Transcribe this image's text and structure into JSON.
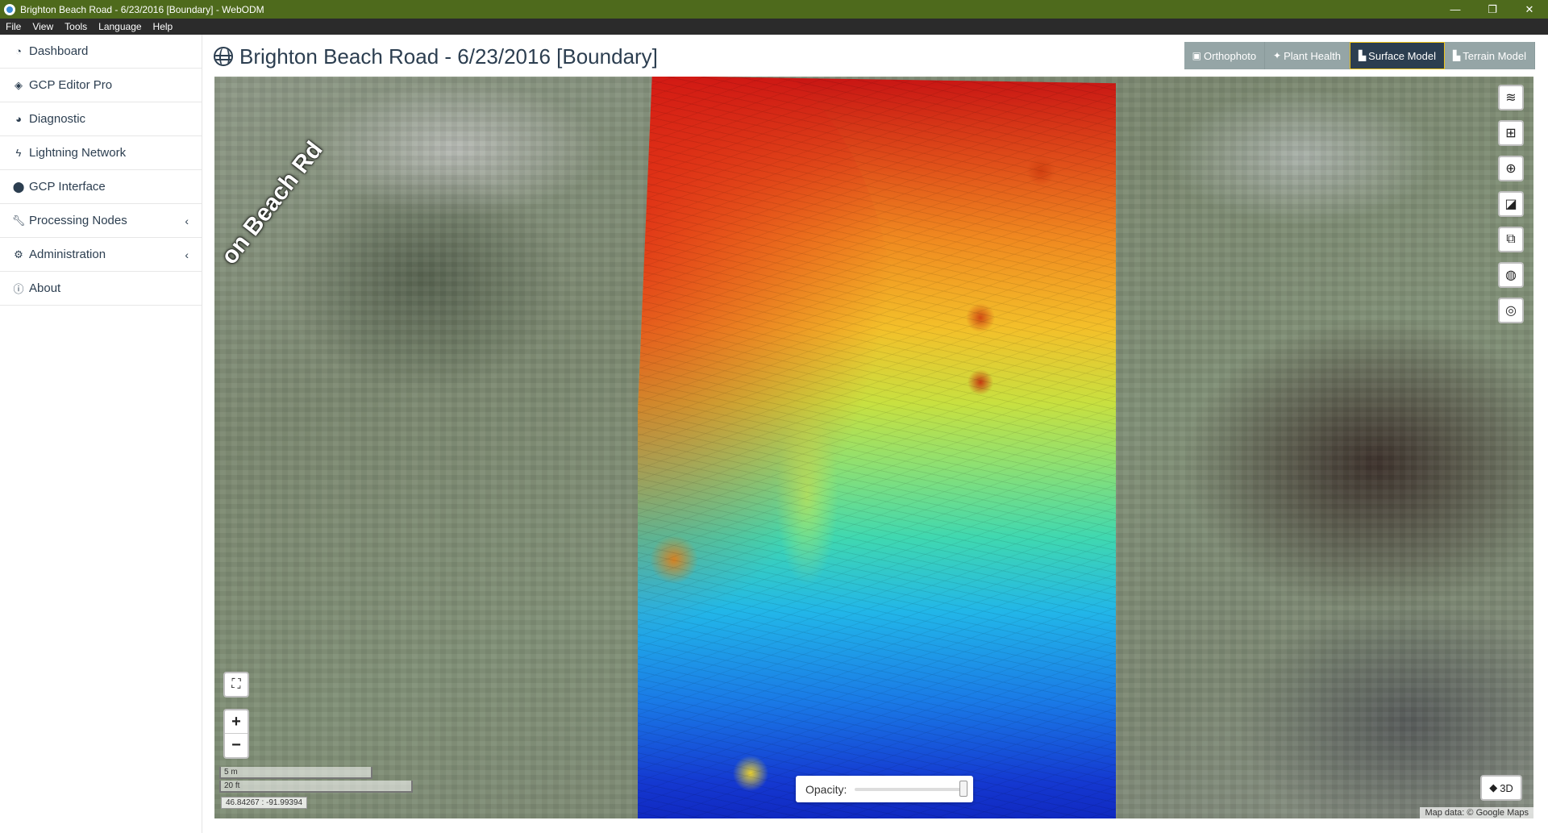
{
  "window": {
    "title": "Brighton Beach Road - 6/23/2016 [Boundary] - WebODM",
    "controls": [
      "—",
      "❐",
      "✕"
    ]
  },
  "menu": [
    "File",
    "View",
    "Tools",
    "Language",
    "Help"
  ],
  "sidebar": {
    "items": [
      {
        "label": "Dashboard",
        "icon": "dashboard-icon"
      },
      {
        "label": "GCP Editor Pro",
        "icon": "gcp-editor-icon"
      },
      {
        "label": "Diagnostic",
        "icon": "pie-chart-icon"
      },
      {
        "label": "Lightning Network",
        "icon": "bolt-icon"
      },
      {
        "label": "GCP Interface",
        "icon": "map-marker-icon"
      },
      {
        "label": "Processing Nodes",
        "icon": "wrench-icon",
        "expandable": true
      },
      {
        "label": "Administration",
        "icon": "cogs-icon",
        "expandable": true
      },
      {
        "label": "About",
        "icon": "info-icon"
      }
    ]
  },
  "header": {
    "title": "Brighton Beach Road - 6/23/2016 [Boundary]"
  },
  "layer_tabs": [
    {
      "label": "Orthophoto",
      "icon": "image-icon",
      "active": false
    },
    {
      "label": "Plant Health",
      "icon": "leaf-icon",
      "active": false
    },
    {
      "label": "Surface Model",
      "icon": "area-chart-icon",
      "active": true
    },
    {
      "label": "Terrain Model",
      "icon": "area-chart-icon",
      "active": false
    }
  ],
  "map": {
    "road_label": "on Beach Rd",
    "scale_metric": "5 m",
    "scale_imperial": "20 ft",
    "coordinates": "46.84267 : -91.99394",
    "opacity_label": "Opacity:",
    "opacity_value": 100,
    "btn_3d": "3D",
    "attribution": "Map data: © Google Maps",
    "right_controls": [
      "layers-icon",
      "grid-icon",
      "add-icon",
      "measure-icon",
      "swipe-icon",
      "contours-icon",
      "target-icon"
    ]
  }
}
